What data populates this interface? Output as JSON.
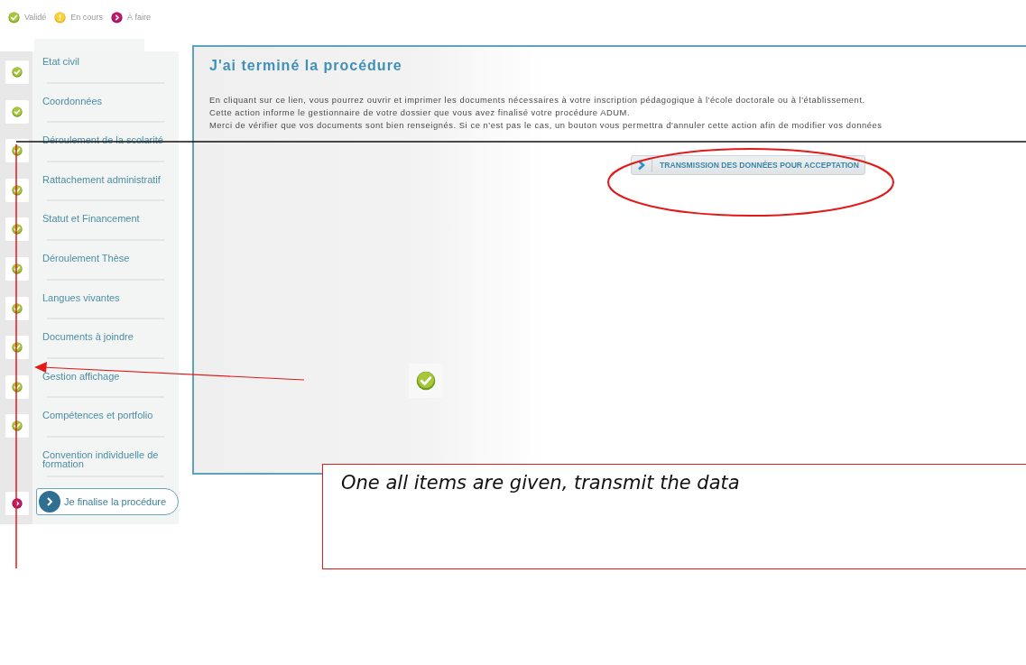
{
  "legend": [
    {
      "label": "Validé",
      "kind": "done"
    },
    {
      "label": "En cours",
      "kind": "progress"
    },
    {
      "label": "À faire",
      "kind": "todo"
    }
  ],
  "steps": [
    {
      "label": "Etat civil",
      "kind": "done",
      "selected": false
    },
    {
      "label": "Coordonnées",
      "kind": "done",
      "selected": false
    },
    {
      "label": "Déroulement de la scolarité",
      "kind": "done",
      "selected": false
    },
    {
      "label": "Rattachement administratif",
      "kind": "done",
      "selected": false
    },
    {
      "label": "Statut et Financement",
      "kind": "done",
      "selected": false
    },
    {
      "label": "Déroulement Thèse",
      "kind": "done",
      "selected": false
    },
    {
      "label": "Langues vivantes",
      "kind": "done",
      "selected": false
    },
    {
      "label": "Documents à joindre",
      "kind": "done",
      "selected": false
    },
    {
      "label": "Gestion affichage",
      "kind": "done",
      "selected": false
    },
    {
      "label": "Compétences et portfolio",
      "kind": "done",
      "selected": false
    },
    {
      "label": "Convention individuelle de formation",
      "kind": "blank",
      "selected": false
    },
    {
      "label": "Je finalise la procédure",
      "kind": "todo",
      "selected": true
    }
  ],
  "panel": {
    "title": "J'ai terminé la procédure",
    "paragraph": [
      "En cliquant sur ce lien, vous pourrez ouvrir et imprimer les documents nécessaires à votre inscription pédagogique à l'école doctorale ou à l'établissement.",
      "Cette action informe le gestionnaire de votre dossier que vous avez finalisé votre procédure ADUM.",
      "Merci de vérifier que vos documents sont bien renseignés. Si ce n'est pas le cas, un bouton vous permettra d'annuler cette action afin de modifier vos données"
    ],
    "button": "TRANSMISSION DES DONNÉES POUR ACCEPTATION"
  },
  "callout": {
    "text": "One all items are given, transmit the data"
  }
}
